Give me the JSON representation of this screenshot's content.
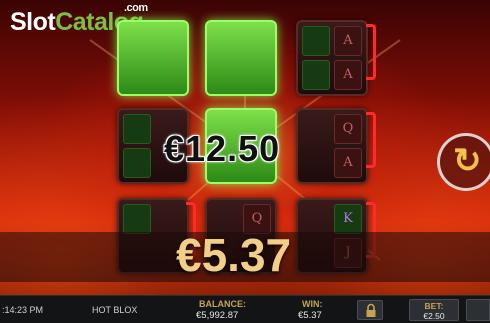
{
  "watermark": {
    "slot": "Slot",
    "catalog": "Catalog",
    "com": ".com"
  },
  "game": {
    "big_win": "€12.50",
    "win_amount": "€5.37"
  },
  "reels": {
    "row1": [
      {
        "state": "hot",
        "symbols": [
          "",
          "",
          "",
          ""
        ]
      },
      {
        "state": "hot",
        "symbols": [
          "",
          "",
          "",
          ""
        ]
      },
      {
        "state": "normal",
        "symbols": [
          "",
          "A",
          "",
          "A"
        ]
      }
    ],
    "row2": [
      {
        "state": "normal",
        "symbols": [
          "",
          "",
          "",
          ""
        ]
      },
      {
        "state": "hot",
        "symbols": [
          "",
          "",
          "",
          ""
        ]
      },
      {
        "state": "normal",
        "symbols": [
          "",
          "Q",
          "",
          "A"
        ]
      }
    ],
    "row3": [
      {
        "state": "normal",
        "symbols": [
          "",
          "",
          "",
          ""
        ]
      },
      {
        "state": "normal",
        "symbols": [
          "",
          "Q",
          "",
          ""
        ]
      },
      {
        "state": "normal",
        "symbols": [
          "",
          "K",
          "",
          "J"
        ]
      }
    ]
  },
  "status_bar": {
    "time": ":14:23 PM",
    "game_name": "HOT BLOX",
    "balance_label": "BALANCE:",
    "balance_value": "€5,992.87",
    "win_label": "WIN:",
    "win_value": "€5.37",
    "bet_label": "BET:",
    "bet_value": "€2.50"
  },
  "icons": {
    "spin": "refresh-icon",
    "lock": "lock-icon"
  },
  "colors": {
    "accent_gold": "#f1cf86",
    "hot_green": "#7ee04a",
    "bracket_red": "#ff2a2a"
  }
}
